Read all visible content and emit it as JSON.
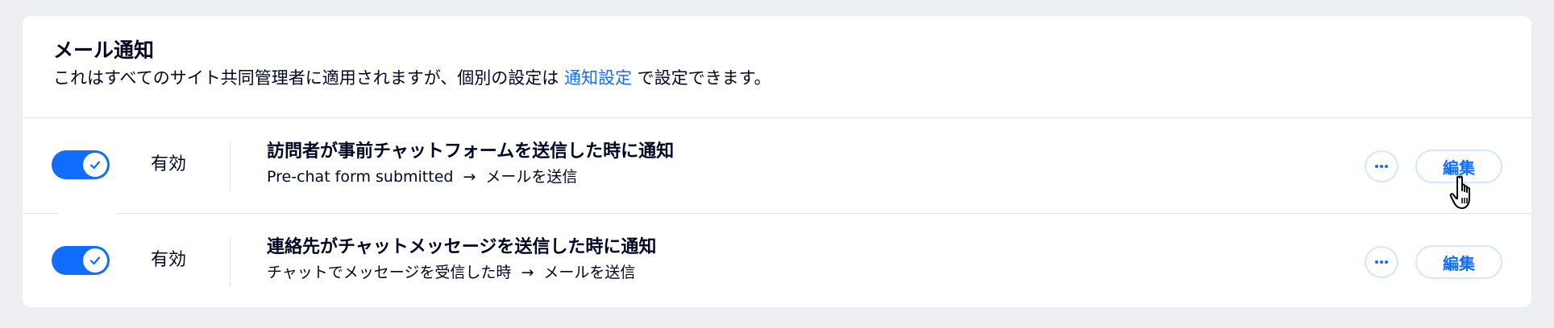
{
  "header": {
    "title": "メール通知",
    "subtitle_prefix": "これはすべてのサイト共同管理者に適用されますが、個別の設定は",
    "subtitle_link": "通知設定",
    "subtitle_suffix": "で設定できます。"
  },
  "rules": [
    {
      "enabled": true,
      "status_label": "有効",
      "title": "訪問者が事前チャットフォームを送信した時に通知",
      "trigger": "Pre-chat form submitted",
      "arrow": "→",
      "action": "メールを送信",
      "more_label": "···",
      "edit_label": "編集"
    },
    {
      "enabled": true,
      "status_label": "有効",
      "title": "連絡先がチャットメッセージを送信した時に通知",
      "trigger": "チャットでメッセージを受信した時",
      "arrow": "→",
      "action": "メールを送信",
      "more_label": "···",
      "edit_label": "編集"
    }
  ],
  "colors": {
    "accent": "#116DFF",
    "background": "#ECEEF2",
    "text": "#000624",
    "button_border": "#D6E6FE"
  },
  "icons": {
    "toggle_check": "check-icon",
    "more": "more-icon",
    "cursor": "hand-pointer-icon"
  }
}
